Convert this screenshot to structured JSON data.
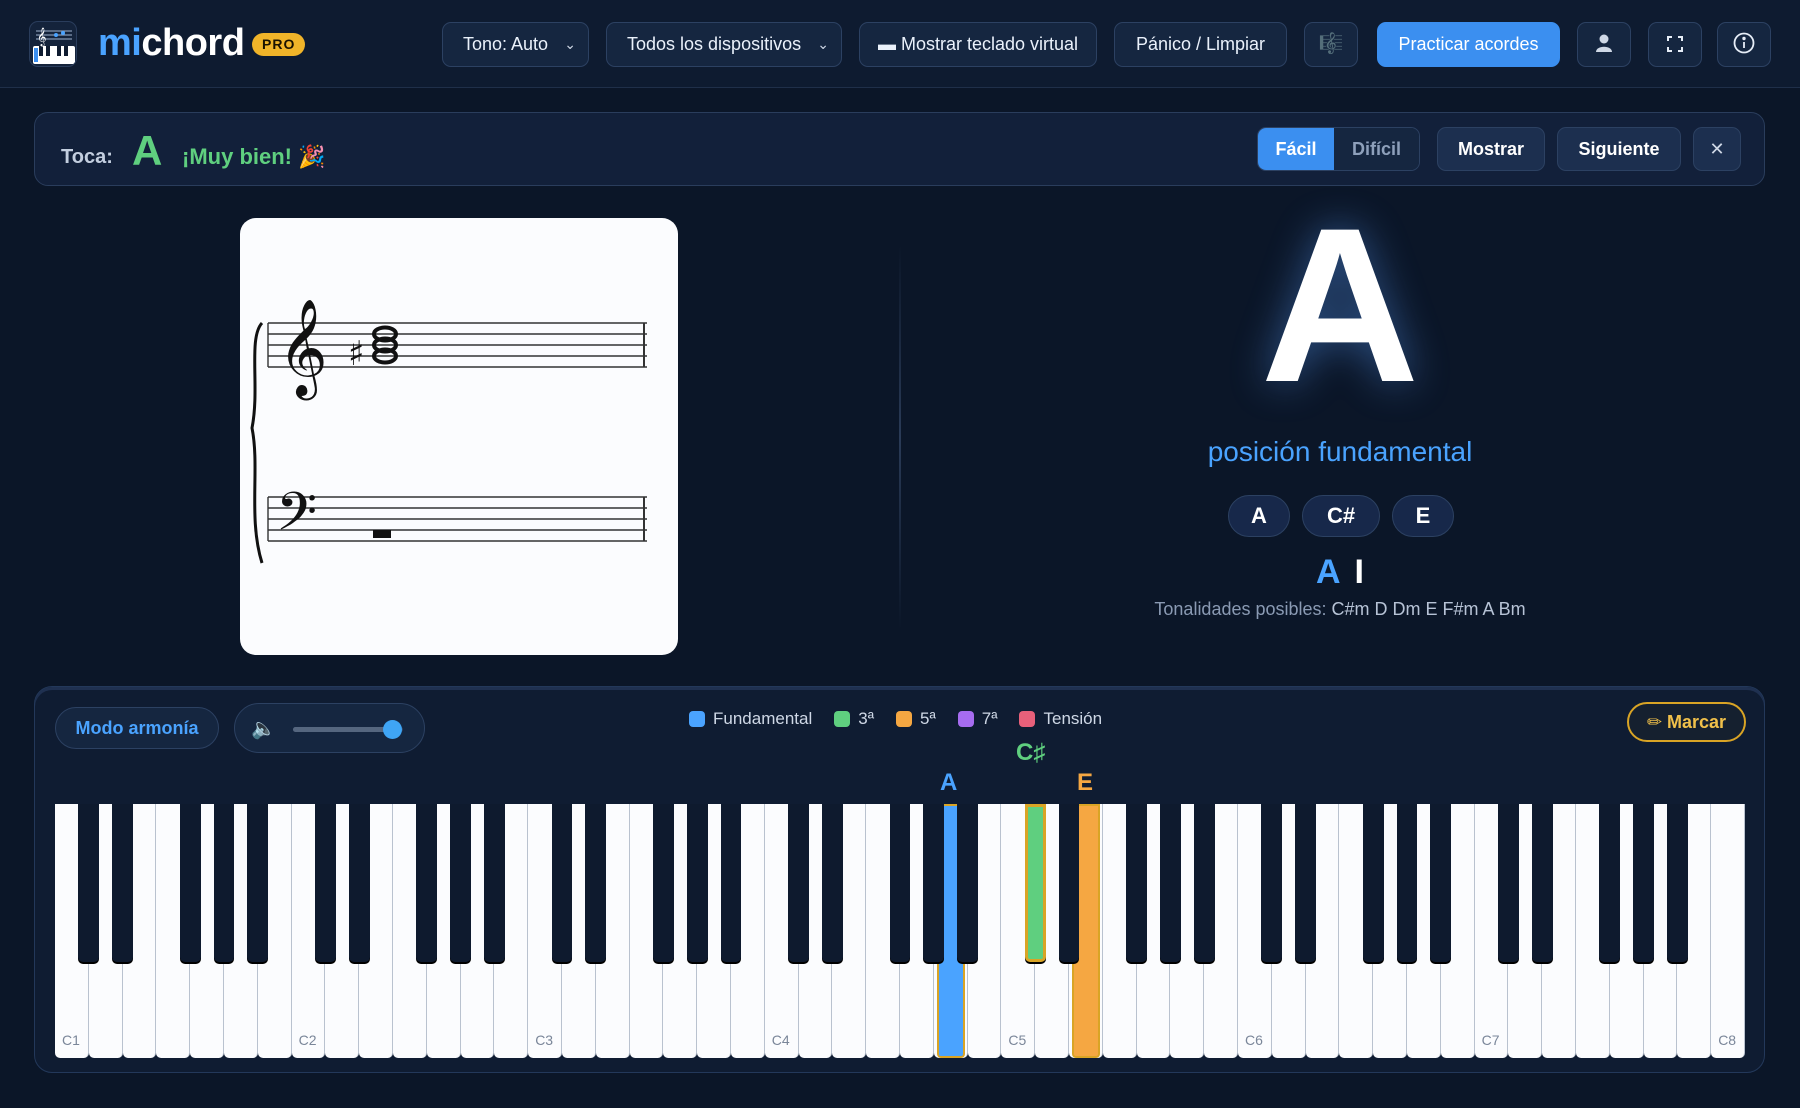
{
  "app": {
    "name_part1": "mi",
    "name_part2": "chord",
    "badge": "PRO"
  },
  "toolbar": {
    "key_select": "Tono: Auto",
    "device_select": "Todos los dispositivos",
    "virtual_keyboard_button": "▬ Mostrar teclado virtual",
    "panic_button": "Pánico / Limpiar",
    "practice_button": "Practicar acordes"
  },
  "prompt": {
    "label": "Toca:",
    "chord": "A",
    "message": "¡Muy bien! 🎉",
    "difficulty_easy": "Fácil",
    "difficulty_hard": "Difícil",
    "difficulty_selected": "Fácil",
    "show_button": "Mostrar",
    "next_button": "Siguiente",
    "close_glyph": "✕"
  },
  "score": {
    "treble_accidental": "♯",
    "treble_chord_notes": [
      "A4",
      "C#5",
      "E5"
    ],
    "bass_content": "rest"
  },
  "chord_display": {
    "name": "A",
    "inversion": "posición fundamental",
    "notes": [
      "A",
      "C#",
      "E"
    ],
    "roman_key": "A",
    "roman_numeral": "I",
    "tonalities_label": "Tonalidades posibles:",
    "tonalities": "C#m D Dm E F#m A Bm"
  },
  "piano": {
    "harmony_button": "Modo armonía",
    "volume": 0.9,
    "legend": [
      {
        "label": "Fundamental",
        "color": "#4aa3ff"
      },
      {
        "label": "3ª",
        "color": "#5fcf7f"
      },
      {
        "label": "5ª",
        "color": "#f5a742"
      },
      {
        "label": "7ª",
        "color": "#a66cf0"
      },
      {
        "label": "Tensión",
        "color": "#e8607a"
      }
    ],
    "mark_button": "✏ Marcar",
    "octave_labels": [
      "C1",
      "C2",
      "C3",
      "C4",
      "C5",
      "C6",
      "C7",
      "C8"
    ],
    "highlighted": [
      {
        "note": "A",
        "key": "A4",
        "role": "Fundamental",
        "color": "#4aa3ff"
      },
      {
        "note": "C♯",
        "key": "C#5",
        "role": "3ª",
        "color": "#5fcf7f"
      },
      {
        "note": "E",
        "key": "E5",
        "role": "5ª",
        "color": "#f5a742"
      }
    ]
  }
}
